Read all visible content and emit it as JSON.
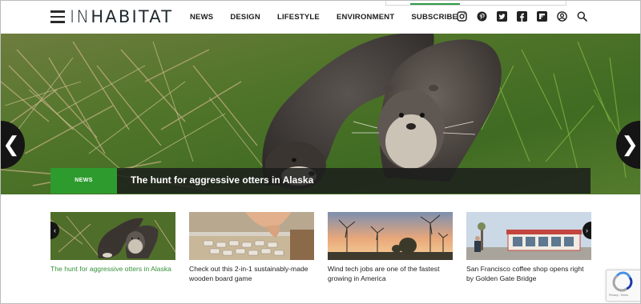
{
  "header": {
    "logo_left": "IN",
    "logo_right": "HABITAT",
    "nav": [
      "NEWS",
      "DESIGN",
      "LIFESTYLE",
      "ENVIRONMENT",
      "SUBSCRIBE"
    ],
    "social_icons": [
      "instagram-icon",
      "pinterest-icon",
      "twitter-icon",
      "facebook-icon",
      "flipboard-icon",
      "account-icon",
      "search-icon"
    ]
  },
  "hero": {
    "badge": "NEWS",
    "title": "The hunt for aggressive otters in Alaska",
    "prev_glyph": "❮",
    "next_glyph": "❯"
  },
  "cards": [
    {
      "title": "The hunt for aggressive otters in Alaska",
      "active": true
    },
    {
      "title": "Check out this 2-in-1 sustainably-made wooden board game",
      "active": false
    },
    {
      "title": "Wind tech jobs are one of the fastest growing in America",
      "active": false
    },
    {
      "title": "San Francisco coffee shop opens right by Golden Gate Bridge",
      "active": false
    }
  ],
  "card_arrows": {
    "prev": "‹",
    "next": "›"
  },
  "recaptcha": {
    "label": "Privacy - Terms"
  },
  "colors": {
    "accent_green": "#2e9b2e",
    "active_link_green": "#37913a",
    "dark": "#151515"
  }
}
